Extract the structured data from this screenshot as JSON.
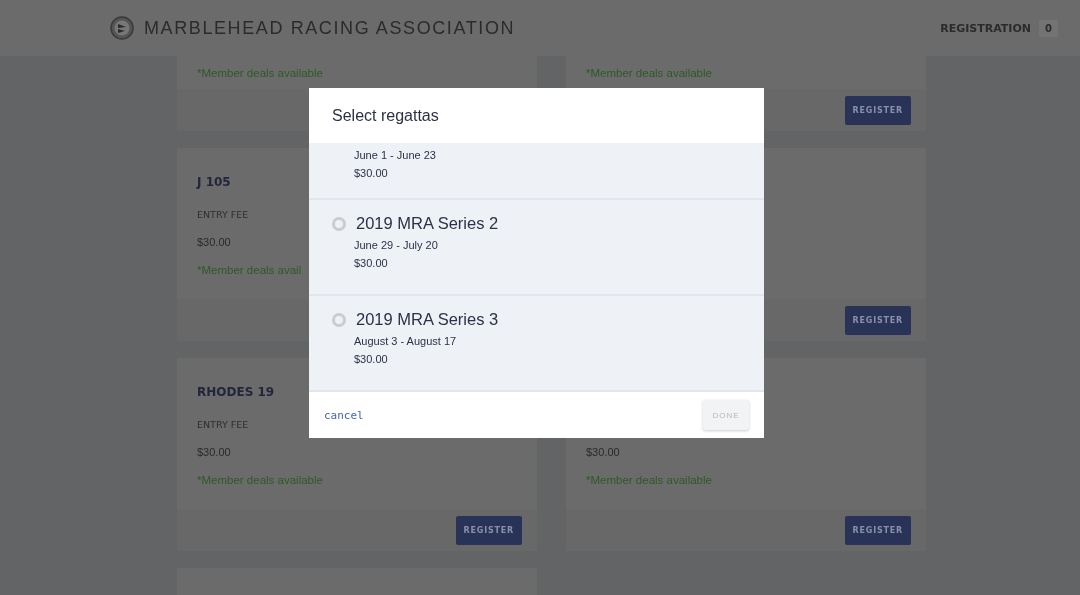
{
  "header": {
    "title": "MARBLEHEAD RACING ASSOCIATION",
    "registration_label": "REGISTRATION",
    "registration_count": "0"
  },
  "cards": [
    {
      "note": "*Member deals available"
    },
    {
      "note": "*Member deals available",
      "button": "REGISTER"
    },
    {
      "title": "J 105",
      "fee_label": "ENTRY FEE",
      "fee": "$30.00",
      "note": "*Member deals avail"
    },
    {
      "button": "REGISTER"
    },
    {
      "title": "RHODES 19",
      "fee_label": "ENTRY FEE",
      "fee": "$30.00",
      "note": "*Member deals available",
      "button": "REGISTER"
    },
    {
      "fee": "$30.00",
      "note": "*Member deals available",
      "button": "REGISTER"
    }
  ],
  "modal": {
    "title": "Select regattas",
    "regattas": [
      {
        "dates": "June 1 - June 23",
        "price": "$30.00"
      },
      {
        "name": "2019 MRA Series 2",
        "dates": "June 29 - July 20",
        "price": "$30.00",
        "selected": false
      },
      {
        "name": "2019 MRA Series 3",
        "dates": "August 3 - August 17",
        "price": "$30.00",
        "selected": false
      }
    ],
    "cancel": "cancel",
    "done": {
      "label": "DONE",
      "disabled": true
    }
  }
}
